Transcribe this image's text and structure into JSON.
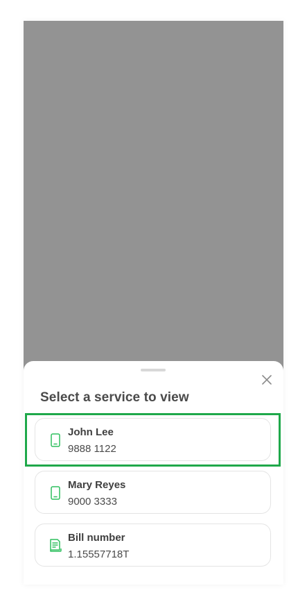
{
  "sheet": {
    "title": "Select a service to view"
  },
  "services": [
    {
      "name": "John Lee",
      "number": "9888 1122",
      "icon": "mobile-phone-icon"
    },
    {
      "name": "Mary Reyes",
      "number": "9000 3333",
      "icon": "mobile-phone-icon"
    },
    {
      "name": "Bill number",
      "number": "1.15557718T",
      "icon": "bill-document-icon"
    }
  ],
  "colors": {
    "accent": "#2fbf5f",
    "highlight": "#1fa84a",
    "overlay": "#939393"
  }
}
